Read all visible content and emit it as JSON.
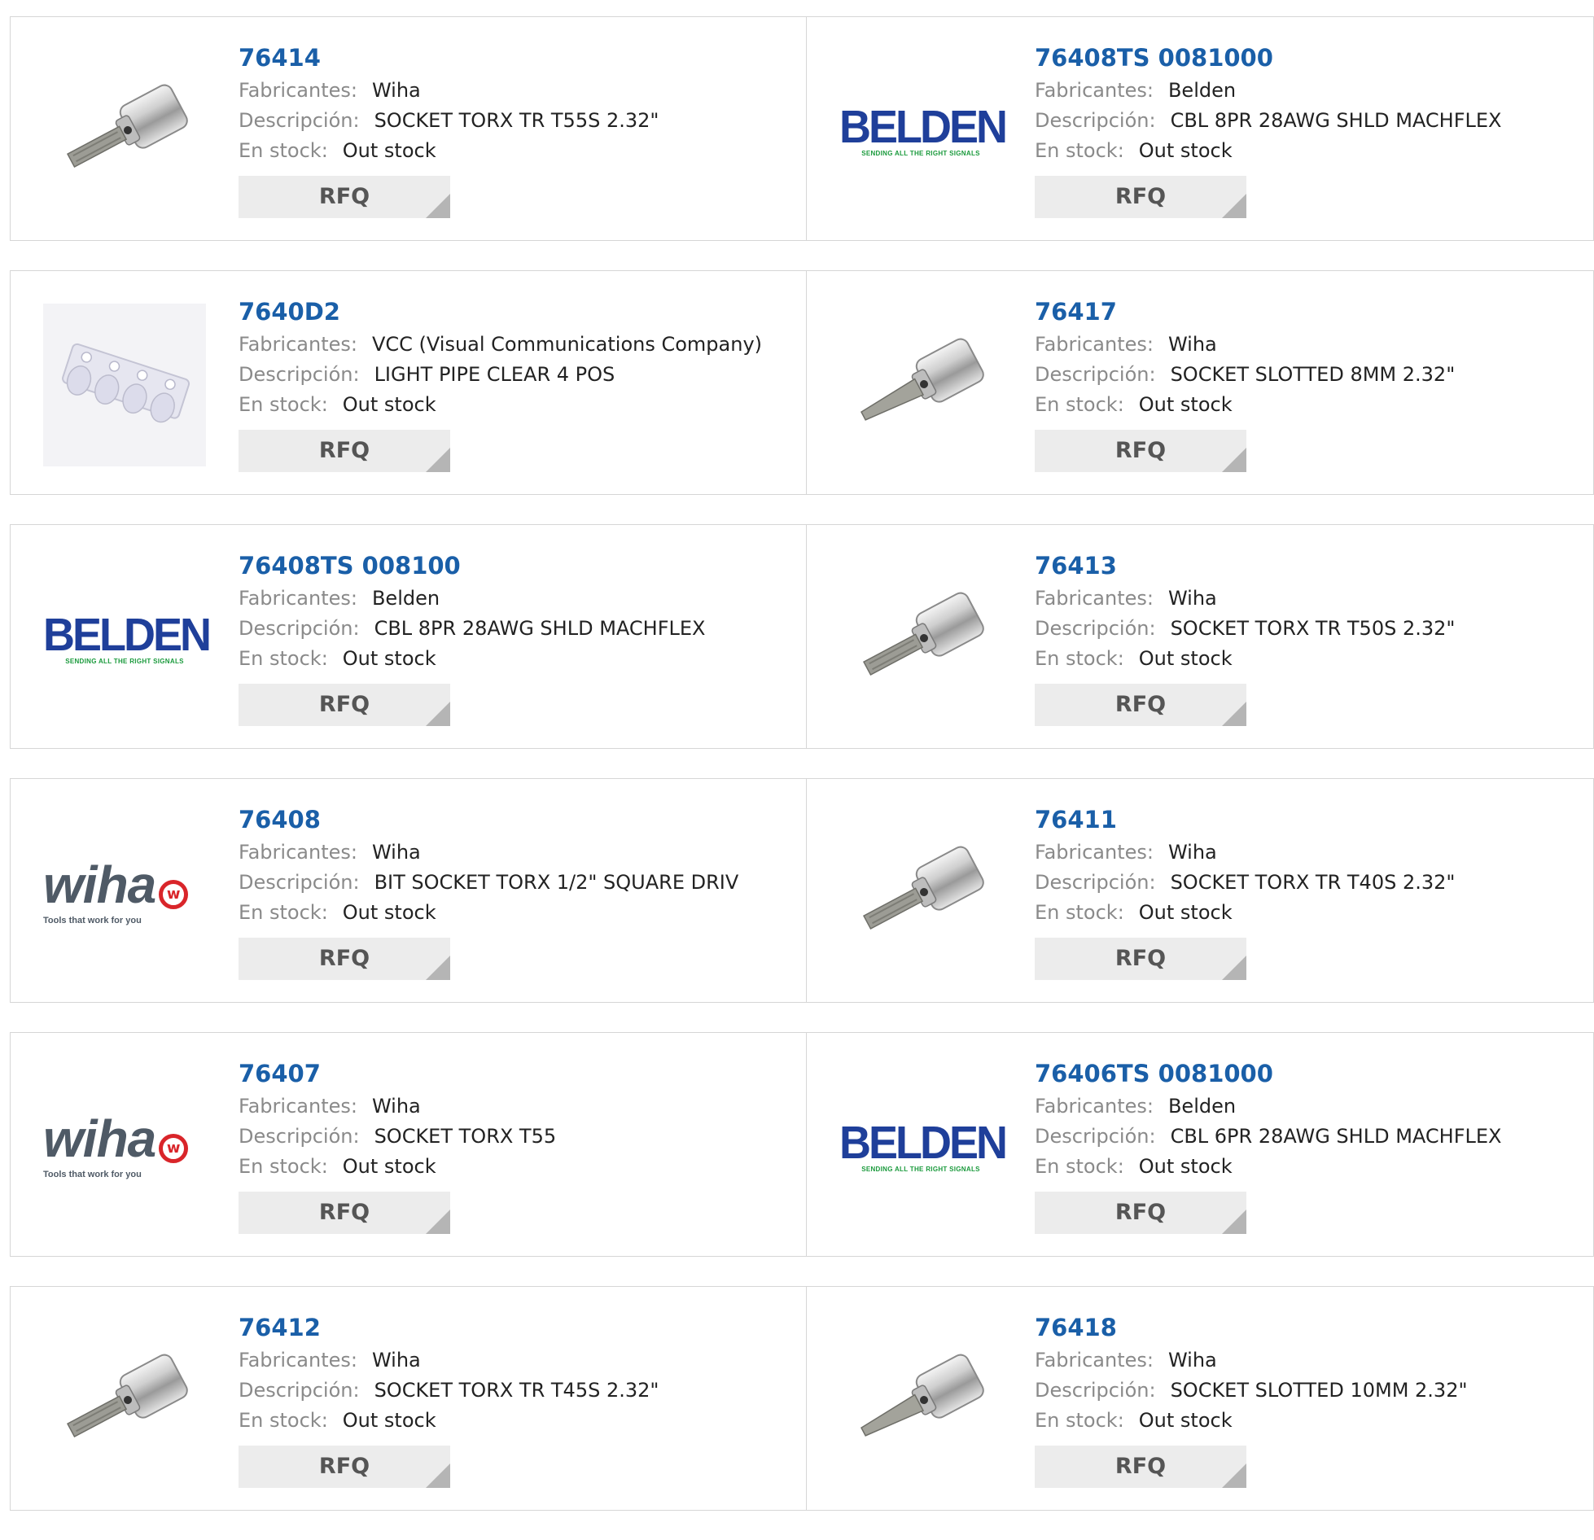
{
  "labels": {
    "manufacturer": "Fabricantes:",
    "description": "Descripción:",
    "stock": "En stock:",
    "rfq": "RFQ"
  },
  "logos": {
    "belden_word": "BELDEN",
    "belden_tag": "SENDING ALL THE RIGHT SIGNALS",
    "wiha_word": "wiha",
    "wiha_tag": "Tools that work for you"
  },
  "colors": {
    "part_link": "#1a5fa8",
    "label": "#8a8a8a",
    "rfq_bg": "#ececec",
    "border": "#d6d6d6"
  },
  "products": [
    {
      "part": "76414",
      "manufacturer": "Wiha",
      "description": "SOCKET TORX TR T55S 2.32\"",
      "stock": "Out stock",
      "image": "socket-torx-icon"
    },
    {
      "part": "76408TS 0081000",
      "manufacturer": "Belden",
      "description": "CBL 8PR 28AWG SHLD MACHFLEX",
      "stock": "Out stock",
      "image": "belden-logo"
    },
    {
      "part": "7640D2",
      "manufacturer": "VCC (Visual Communications Company)",
      "description": "LIGHT PIPE CLEAR 4 POS",
      "stock": "Out stock",
      "image": "light-pipe-icon"
    },
    {
      "part": "76417",
      "manufacturer": "Wiha",
      "description": "SOCKET SLOTTED 8MM 2.32\"",
      "stock": "Out stock",
      "image": "socket-slotted-icon"
    },
    {
      "part": "76408TS 008100",
      "manufacturer": "Belden",
      "description": "CBL 8PR 28AWG SHLD MACHFLEX",
      "stock": "Out stock",
      "image": "belden-logo"
    },
    {
      "part": "76413",
      "manufacturer": "Wiha",
      "description": "SOCKET TORX TR T50S 2.32\"",
      "stock": "Out stock",
      "image": "socket-torx-icon"
    },
    {
      "part": "76408",
      "manufacturer": "Wiha",
      "description": "BIT SOCKET TORX 1/2\" SQUARE DRIV",
      "stock": "Out stock",
      "image": "wiha-logo"
    },
    {
      "part": "76411",
      "manufacturer": "Wiha",
      "description": "SOCKET TORX TR T40S 2.32\"",
      "stock": "Out stock",
      "image": "socket-torx-icon"
    },
    {
      "part": "76407",
      "manufacturer": "Wiha",
      "description": "SOCKET TORX T55",
      "stock": "Out stock",
      "image": "wiha-logo"
    },
    {
      "part": "76406TS 0081000",
      "manufacturer": "Belden",
      "description": "CBL 6PR 28AWG SHLD MACHFLEX",
      "stock": "Out stock",
      "image": "belden-logo"
    },
    {
      "part": "76412",
      "manufacturer": "Wiha",
      "description": "SOCKET TORX TR T45S 2.32\"",
      "stock": "Out stock",
      "image": "socket-torx-icon"
    },
    {
      "part": "76418",
      "manufacturer": "Wiha",
      "description": "SOCKET SLOTTED 10MM 2.32\"",
      "stock": "Out stock",
      "image": "socket-slotted-icon"
    }
  ]
}
